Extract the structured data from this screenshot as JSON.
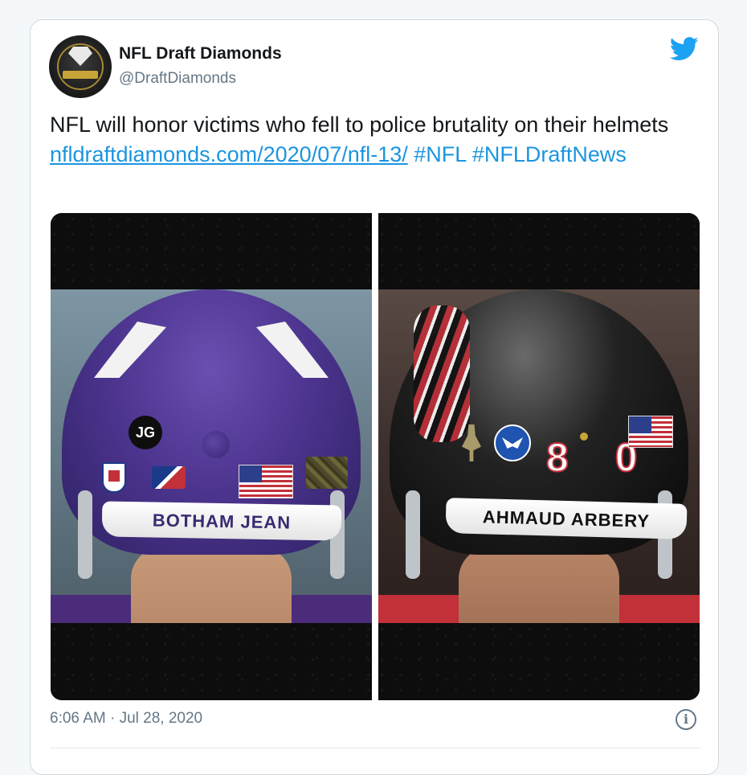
{
  "tweet": {
    "author_name": "NFL Draft Diamonds",
    "author_handle": "@DraftDiamonds",
    "text_main": "NFL will honor victims who fell to police brutality on their helmets ",
    "link": "nfldraftdiamonds.com/2020/07/nfl-13/",
    "hashtags": [
      "#NFL",
      "#NFLDraftNews"
    ],
    "timestamp": "6:06 AM · Jul 28, 2020"
  },
  "media": {
    "left": {
      "initials": "JG",
      "nameplate": "BOTHAM JEAN",
      "helmet_color": "#4d3590"
    },
    "right": {
      "number": "8 0",
      "nameplate": "AHMAUD ARBERY",
      "helmet_color": "#111111"
    }
  },
  "icons": {
    "platform": "twitter-bird-icon",
    "info": "info-icon",
    "info_glyph": "i"
  },
  "colors": {
    "accent": "#1da1f2",
    "link": "#1b95e0",
    "secondary_text": "#657786"
  }
}
